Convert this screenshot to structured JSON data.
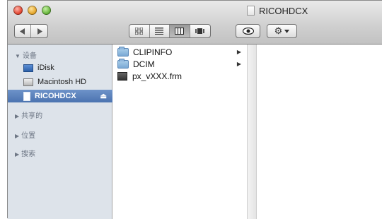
{
  "window": {
    "title": "RICOHDCX"
  },
  "toolbar": {
    "back_icon": "triangle-left-icon",
    "forward_icon": "triangle-right-icon",
    "view_modes": [
      "icon-view",
      "list-view",
      "column-view",
      "coverflow-view"
    ],
    "selected_view": "column-view",
    "quicklook_icon": "eye-icon",
    "action_icon": "gear-icon"
  },
  "sidebar": {
    "sections": {
      "devices": "设备",
      "shared": "共享的",
      "places": "位置",
      "search": "搜索"
    },
    "items": [
      {
        "label": "iDisk",
        "icon": "idisk-icon"
      },
      {
        "label": "Macintosh HD",
        "icon": "hard-drive-icon"
      },
      {
        "label": "RICOHDCX",
        "icon": "removable-disk-icon",
        "selected": true
      }
    ]
  },
  "columns": [
    {
      "entries": [
        {
          "name": "CLIPINFO",
          "kind": "folder",
          "has_children": true
        },
        {
          "name": "DCIM",
          "kind": "folder",
          "has_children": true
        },
        {
          "name": "px_vXXX.frm",
          "kind": "file",
          "has_children": false
        }
      ]
    }
  ],
  "colors": {
    "sidebar_bg": "#dde3ea",
    "selection": "#5a80bb"
  }
}
